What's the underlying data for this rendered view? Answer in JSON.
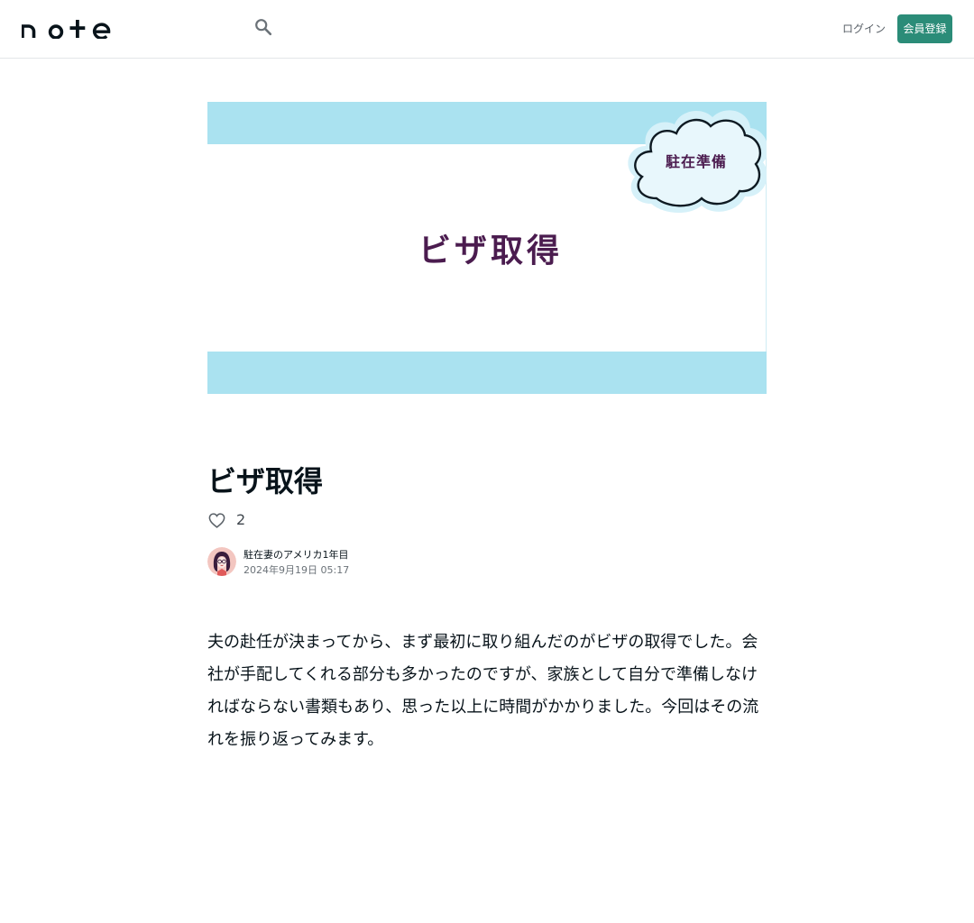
{
  "header": {
    "logo_text": "note",
    "search_icon": "search-icon",
    "login_label": "ログイン",
    "signup_label": "会員登録"
  },
  "eyecatch": {
    "title": "ビザ取得",
    "cloud_label": "駐在準備",
    "colors": {
      "band": "#aae2f0",
      "text": "#4b1c4f",
      "cloud_fill": "#e8f7fc"
    }
  },
  "article": {
    "title": "ビザ取得",
    "like_icon": "heart-outline-icon",
    "like_count": "2",
    "author_name": "駐在妻のアメリカ1年目",
    "post_date": "2024年9月19日 05:17",
    "body": "夫の赴任が決まってから、まず最初に取り組んだのがビザの取得でした。会社が手配してくれる部分も多かったのですが、家族として自分で準備しなければならない書類もあり、思った以上に時間がかかりました。今回はその流れを振り返ってみます。"
  },
  "colors": {
    "accent": "#2b8c78",
    "divider": "#e3e6e8"
  }
}
